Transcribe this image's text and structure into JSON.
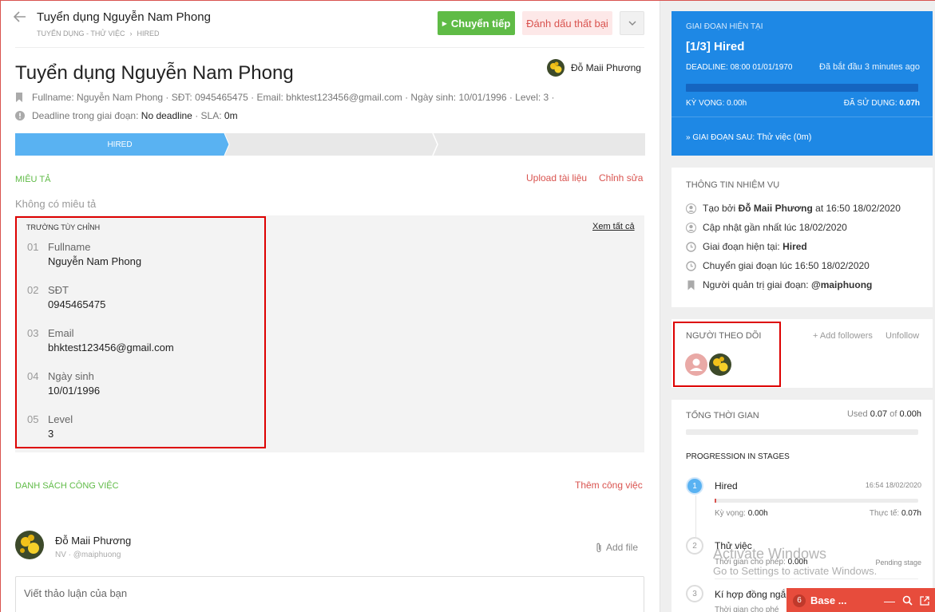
{
  "header": {
    "title": "Tuyển dụng Nguyễn Nam Phong",
    "breadcrumb": [
      "TUYỂN DỤNG - THỬ VIỆC",
      "HIRED"
    ],
    "forward_button": "Chuyển tiếp",
    "fail_button": "Đánh dấu thất bại"
  },
  "job": {
    "title": "Tuyển dụng Nguyễn Nam Phong",
    "owner": "Đỗ Maii Phương",
    "info_line": "Fullname: Nguyễn Nam Phong · SĐT: 0945465475 · Email: bhktest123456@gmail.com · Ngày sinh: 10/01/1996 · Level: 3 ·",
    "deadline_label": "Deadline trong giai đoạn:",
    "deadline_value": "No deadline",
    "sla_label": "· SLA:",
    "sla_value": "0m"
  },
  "stages": {
    "current": "HIRED"
  },
  "description": {
    "title": "MIÊU TẢ",
    "upload": "Upload tài liệu",
    "edit": "Chỉnh sửa",
    "empty": "Không có miêu tả"
  },
  "custom_fields": {
    "title": "TRƯỜNG TÙY CHỈNH",
    "view_all": "Xem tất cả",
    "items": [
      {
        "num": "01",
        "label": "Fullname",
        "value": "Nguyễn Nam Phong"
      },
      {
        "num": "02",
        "label": "SĐT",
        "value": "0945465475"
      },
      {
        "num": "03",
        "label": "Email",
        "value": "bhktest123456@gmail.com"
      },
      {
        "num": "04",
        "label": "Ngày sinh",
        "value": "10/01/1996"
      },
      {
        "num": "05",
        "label": "Level",
        "value": "3"
      }
    ]
  },
  "tasks": {
    "title": "DANH SÁCH CÔNG VIỆC",
    "add": "Thêm công việc"
  },
  "comment": {
    "user": "Đỗ Maii Phương",
    "meta": "NV · @maiphuong",
    "add_file": "Add file",
    "placeholder": "Viết thảo luận của bạn"
  },
  "current_stage": {
    "label": "GIAI ĐOẠN HIỆN TẠI",
    "name": "[1/3] Hired",
    "deadline": "DEADLINE: 08:00 01/01/1970",
    "started": "Đã bắt đầu 3 minutes ago",
    "expected": "KỲ VỌNG: 0.00h",
    "used_label": "ĐÃ SỬ DỤNG:",
    "used_value": "0.07h",
    "next": "» GIAI ĐOẠN SAU:",
    "next_value": "Thử việc (0m)"
  },
  "task_info": {
    "title": "THÔNG TIN NHIỆM VỤ",
    "created_pre": "Tạo bởi",
    "created_by": "Đỗ Maii Phương",
    "created_post": "at 16:50 18/02/2020",
    "updated": "Cập nhật gần nhất lúc 18/02/2020",
    "current_pre": "Giai đoạn hiện tại:",
    "current_val": "Hired",
    "moved": "Chuyển giai đoạn lúc 16:50 18/02/2020",
    "manager_pre": "Người quản trị giai đoạn:",
    "manager_val": "@maiphuong"
  },
  "followers": {
    "title": "NGƯỜI THEO DÕI",
    "add": "+ Add followers",
    "unfollow": "Unfollow"
  },
  "total_time": {
    "title": "TỔNG THỜI GIAN",
    "used_pre": "Used",
    "used": "0.07",
    "of": "of",
    "total": "0.00h",
    "progression_title": "PROGRESSION IN STAGES",
    "stages": [
      {
        "num": "1",
        "name": "Hired",
        "time": "16:54 18/02/2020",
        "expected_label": "Kỳ vọng:",
        "expected": "0.00h",
        "actual_label": "Thực tế:",
        "actual": "0.07h"
      },
      {
        "num": "2",
        "name": "Thử việc",
        "allowed_label": "Thời gian cho phép:",
        "allowed": "0.00h",
        "status": "Pending stage"
      },
      {
        "num": "3",
        "name": "Kí hợp đồng ngắ",
        "allowed_label": "Thời gian cho phé"
      }
    ]
  },
  "watermark": {
    "line1": "Activate Windows",
    "line2": "Go to Settings to activate Windows."
  },
  "chat": {
    "count": "6",
    "label": "Base ..."
  },
  "colors": {
    "accent_blue": "#1e88e5",
    "green": "#5fbb46",
    "red": "#d9534f"
  }
}
